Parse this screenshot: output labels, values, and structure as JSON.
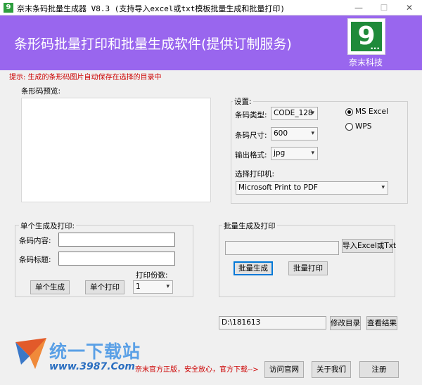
{
  "window": {
    "title": "奈末条码批量生成器 V8.3   (支持导入excel或txt模板批量生成和批量打印)",
    "app_icon": "9",
    "minimize": "—",
    "maximize": "☐",
    "close": "✕"
  },
  "banner": {
    "title": "条形码批量打印和批量生成软件(提供订制服务)",
    "logo_digit": "9",
    "logo_dots": "...",
    "brand": "奈末科技",
    "color": "#9966ee"
  },
  "hint": "提示: 生成的条形码图片自动保存在选择的目录中",
  "preview": {
    "label": "条形码预览:"
  },
  "settings": {
    "title": "设置:",
    "type_label": "条码类型:",
    "type_value": "CODE_128",
    "size_label": "条码尺寸:",
    "size_value": "600",
    "format_label": "输出格式:",
    "format_value": "jpg",
    "radio_excel": "MS  Excel",
    "radio_wps": "WPS",
    "printer_label": "选择打印机:",
    "printer_value": "Microsoft Print to PDF"
  },
  "single": {
    "title": "单个生成及打印:",
    "content_label": "条码内容:",
    "content_value": "",
    "caption_label": "条码标题:",
    "caption_value": "",
    "copies_label": "打印份数:",
    "copies_value": "1",
    "generate_button": "单个生成",
    "print_button": "单个打印"
  },
  "batch": {
    "title": "批量生成及打印",
    "file_value": "",
    "import_button": "导入Excel或Txt",
    "generate_button": "批量生成",
    "print_button": "批量打印"
  },
  "output": {
    "dir_value": "D:\\181613",
    "change_dir_button": "修改目录",
    "view_result_button": "查看结果"
  },
  "footer": {
    "watermark_title": "统一下载站",
    "watermark_url": "www.3987.Com",
    "note": "奈末官方正版，安全放心，官方下载-->",
    "visit_button": "访问官网",
    "about_button": "关于我们",
    "register_button": "注册"
  },
  "colors": {
    "accent": "#0078d7",
    "hint": "#cc0000",
    "logo_green": "#1f8a3a"
  }
}
